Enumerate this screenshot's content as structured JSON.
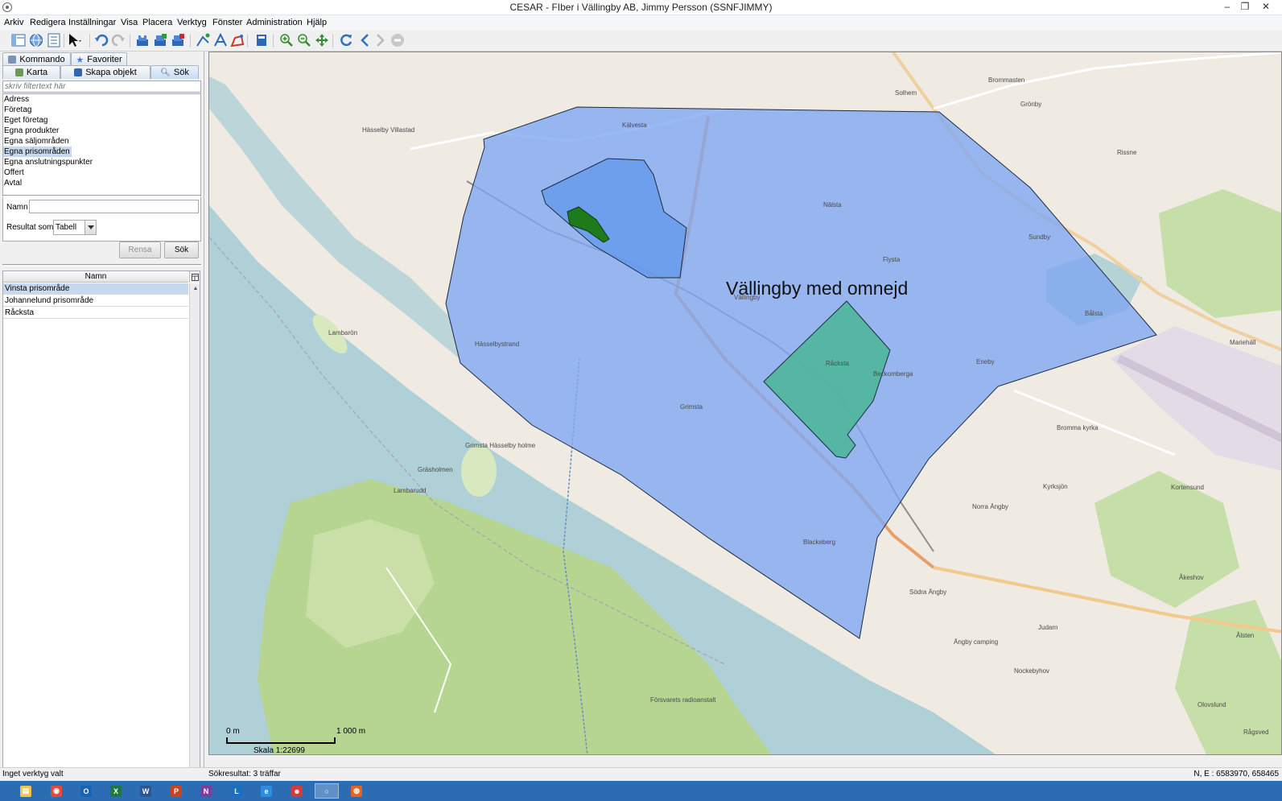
{
  "window": {
    "title": "CESAR - FIber i Vällingby AB, Jimmy Persson (SSNFJIMMY)",
    "minimize": "–",
    "restore": "❐",
    "close": "✕"
  },
  "menu": [
    "Arkiv",
    "Redigera",
    "Inställningar",
    "Visa",
    "Placera",
    "Verktyg",
    "Fönster",
    "Administration",
    "Hjälp"
  ],
  "toolbar": {
    "icons": [
      "layout-icon",
      "globe-icon",
      "list-icon",
      "pointer-icon",
      "undo-icon",
      "redo-icon",
      "layers-icon",
      "layers-add-icon",
      "layers-remove-icon",
      "draw-line-icon",
      "draw-text-icon",
      "draw-area-icon",
      "book-icon",
      "zoom-in-icon",
      "zoom-out-icon",
      "pan-icon",
      "refresh-icon",
      "back-icon",
      "forward-icon",
      "stop-icon"
    ]
  },
  "left_panel": {
    "tabs_row1": [
      {
        "label": "Kommando",
        "icon": "command-icon"
      },
      {
        "label": "Favoriter",
        "icon": "star-icon"
      }
    ],
    "tabs_row2": [
      {
        "label": "Karta",
        "icon": "map-icon"
      },
      {
        "label": "Skapa objekt",
        "icon": "create-object-icon"
      },
      {
        "label": "Sök",
        "icon": "search-icon"
      }
    ],
    "active_tab": "Sök",
    "filter_placeholder": "skriv filtertext här",
    "categories": [
      "Adress",
      "Företag",
      "Eget företag",
      "Egna produkter",
      "Egna säljområden",
      "Egna prisområden",
      "Egna anslutningspunkter",
      "Offert",
      "Avtal"
    ],
    "selected_category": "Egna prisområden",
    "name_label": "Namn",
    "name_value": "",
    "result_label": "Resultat som",
    "result_value": "Tabell",
    "clear_button": "Rensa",
    "search_button": "Sök",
    "results_header": "Namn",
    "results": [
      "Vinsta prisområde",
      "Johannelund prisområde",
      "Råcksta"
    ],
    "selected_result": "Vinsta prisområde"
  },
  "map": {
    "area_label": "Vällingby med omnejd",
    "place_labels": [
      "Solhem",
      "Brommasten",
      "Kälvesta",
      "Hässelby Villastad",
      "Nälsta",
      "Flysta",
      "Sundby",
      "Rissne",
      "Hässelbystrand",
      "Vällingby",
      "Råcksta",
      "Eneby",
      "Grimsta",
      "Bålsta",
      "Bromma kyrka",
      "Norra Ängby",
      "Blackeberg",
      "Södra Ängby",
      "Åkeshov",
      "Nockebyhov",
      "Olovslund",
      "Lambarön",
      "Grimsta Hässelby holme",
      "Gräsholmen",
      "Lambarudd",
      "Försvarets radioanstalt",
      "Kyrksjön",
      "Kortensund",
      "Ålsten",
      "Mariehäll",
      "Judarn",
      "Rågsved",
      "Grönby",
      "Beckomberga",
      "Ängby camping"
    ],
    "colors": {
      "polygon_large_fill": "#7da6f2",
      "polygon_racksta_fill": "#4db69a",
      "polygon_vinsta_fill": "#5c96ec",
      "polygon_small_fill": "#1f7a1c",
      "water": "#aed0d6",
      "forest": "#b6d591",
      "land": "#efeae2"
    },
    "scale": {
      "start": "0 m",
      "end": "1 000 m",
      "label": "Skala 1:22699"
    }
  },
  "status": {
    "left": "Inget verktyg valt",
    "middle": "Sökresultat: 3 träffar",
    "right": "N, E : 6583970, 658465"
  },
  "taskbar": {
    "apps": [
      {
        "name": "file-explorer-icon",
        "glyph": "▤",
        "color": "#f3c44b"
      },
      {
        "name": "chrome-icon",
        "glyph": "◉",
        "color": "#e34a3b"
      },
      {
        "name": "outlook-icon",
        "glyph": "O",
        "color": "#1664b5"
      },
      {
        "name": "excel-icon",
        "glyph": "X",
        "color": "#1d7a3f"
      },
      {
        "name": "word-icon",
        "glyph": "W",
        "color": "#2b5797"
      },
      {
        "name": "powerpoint-icon",
        "glyph": "P",
        "color": "#c9441f"
      },
      {
        "name": "onenote-icon",
        "glyph": "N",
        "color": "#7f3b9e"
      },
      {
        "name": "lync-icon",
        "glyph": "L",
        "color": "#1770c4"
      },
      {
        "name": "internet-explorer-icon",
        "glyph": "e",
        "color": "#2d8ee0"
      },
      {
        "name": "messenger-icon",
        "glyph": "☻",
        "color": "#d13b3b"
      },
      {
        "name": "cesar-icon",
        "glyph": "○",
        "color": "#ffffff"
      },
      {
        "name": "firefox-icon",
        "glyph": "◍",
        "color": "#e8641c"
      }
    ],
    "active_app": "cesar-icon"
  }
}
